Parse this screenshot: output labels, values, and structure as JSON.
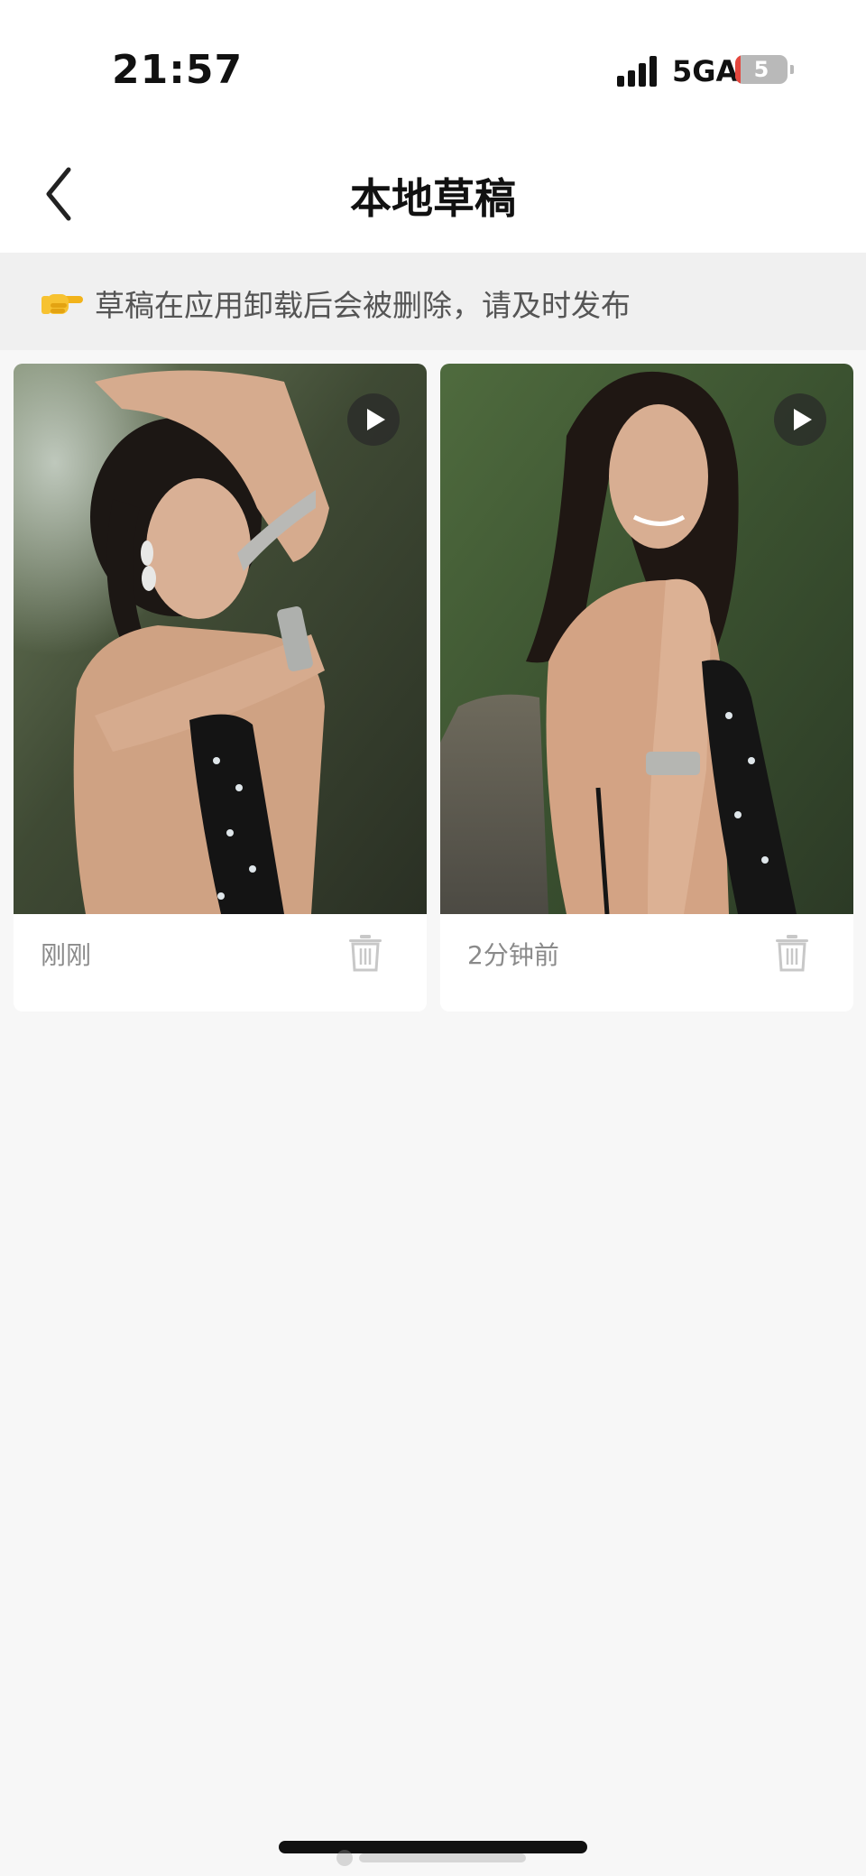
{
  "status_bar": {
    "time": "21:57",
    "network": "5GA",
    "battery": "5"
  },
  "header": {
    "title": "本地草稿"
  },
  "notice": {
    "text": "草稿在应用卸载后会被删除，请及时发布"
  },
  "drafts": [
    {
      "time": "刚刚"
    },
    {
      "time": "2分钟前"
    }
  ]
}
